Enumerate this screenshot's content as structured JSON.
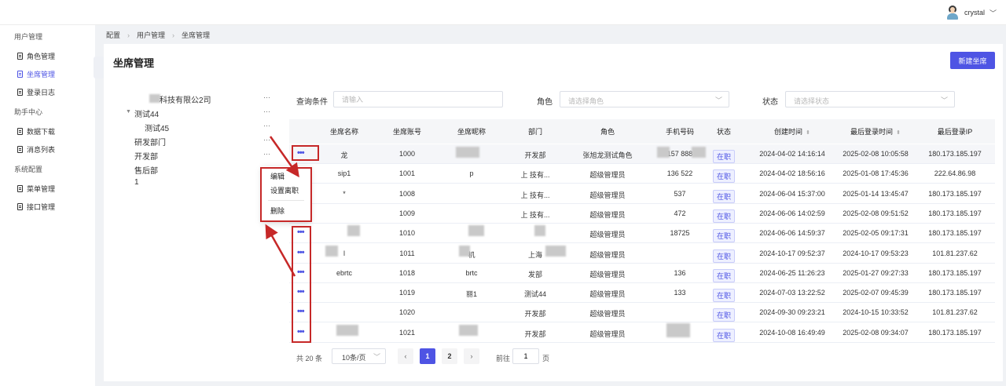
{
  "header": {
    "username": "crystal"
  },
  "sidebar": {
    "groups": [
      {
        "label": "用户管理",
        "items": [
          {
            "label": "角色管理",
            "active": false
          },
          {
            "label": "坐席管理",
            "active": true
          },
          {
            "label": "登录日志",
            "active": false
          }
        ]
      },
      {
        "label": "助手中心",
        "items": [
          {
            "label": "数据下载",
            "active": false
          },
          {
            "label": "消息列表",
            "active": false
          }
        ]
      },
      {
        "label": "系统配置",
        "items": [
          {
            "label": "菜单管理",
            "active": false
          },
          {
            "label": "接口管理",
            "active": false
          }
        ]
      }
    ]
  },
  "breadcrumb": [
    "配置",
    "用户管理",
    "坐席管理"
  ],
  "page": {
    "title": "坐席管理",
    "new_button": "新建坐席"
  },
  "tree": [
    {
      "label": "科技有限公2司"
    },
    {
      "label": "测试44"
    },
    {
      "label": "测试45"
    },
    {
      "label": "研发部门"
    },
    {
      "label": "开发部"
    },
    {
      "label": "售后部"
    },
    {
      "label": "1"
    }
  ],
  "filters": {
    "query_label": "查询条件",
    "query_placeholder": "请输入",
    "role_label": "角色",
    "role_placeholder": "请选择角色",
    "status_label": "状态",
    "status_placeholder": "请选择状态"
  },
  "table": {
    "headers": [
      "坐席名称",
      "坐席账号",
      "坐席昵称",
      "部门",
      "角色",
      "手机号码",
      "状态",
      "创建时间",
      "最后登录时间",
      "最后登录IP"
    ],
    "rows": [
      {
        "name": "龙",
        "account": "1000",
        "nickname": "",
        "dept": "开发部",
        "role": "张旭龙测试角色",
        "phone": "157   888",
        "status": "在职",
        "created": "2024-04-02 14:16:14",
        "last_login": "2025-02-08 10:05:58",
        "ip": "180.173.185.197"
      },
      {
        "name": "sip1",
        "account": "1001",
        "nickname": "p",
        "dept": "上   技有...",
        "role": "超级管理员",
        "phone": "136   522",
        "status": "在职",
        "created": "2024-04-02 18:56:16",
        "last_login": "2025-01-08 17:45:36",
        "ip": "222.64.86.98"
      },
      {
        "name": "*",
        "account": "1008",
        "nickname": "",
        "dept": "上   技有...",
        "role": "超级管理员",
        "phone": "537",
        "status": "在职",
        "created": "2024-06-04 15:37:00",
        "last_login": "2025-01-14 13:45:47",
        "ip": "180.173.185.197"
      },
      {
        "name": "",
        "account": "1009",
        "nickname": "",
        "dept": "上   技有...",
        "role": "超级管理员",
        "phone": "472",
        "status": "在职",
        "created": "2024-06-06 14:02:59",
        "last_login": "2025-02-08 09:51:52",
        "ip": "180.173.185.197"
      },
      {
        "name": "",
        "account": "1010",
        "nickname": "",
        "dept": "",
        "role": "超级管理员",
        "phone": "18725",
        "status": "在职",
        "created": "2024-06-06 14:59:37",
        "last_login": "2025-02-05 09:17:31",
        "ip": "180.173.185.197"
      },
      {
        "name": "l",
        "account": "1011",
        "nickname": "机",
        "dept": "上海",
        "role": "超级管理员",
        "phone": "",
        "status": "在职",
        "created": "2024-10-17 09:52:37",
        "last_login": "2024-10-17 09:53:23",
        "ip": "101.81.237.62"
      },
      {
        "name": "ebrtc",
        "account": "1018",
        "nickname": "brtc",
        "dept": "发部",
        "role": "超级管理员",
        "phone": "136",
        "status": "在职",
        "created": "2024-06-25 11:26:23",
        "last_login": "2025-01-27 09:27:33",
        "ip": "180.173.185.197"
      },
      {
        "name": "",
        "account": "1019",
        "nickname": "丽1",
        "dept": "测试44",
        "role": "超级管理员",
        "phone": "133",
        "status": "在职",
        "created": "2024-07-03 13:22:52",
        "last_login": "2025-02-07 09:45:39",
        "ip": "180.173.185.197"
      },
      {
        "name": "",
        "account": "1020",
        "nickname": "",
        "dept": "开发部",
        "role": "超级管理员",
        "phone": "",
        "status": "在职",
        "created": "2024-09-30 09:23:21",
        "last_login": "2024-10-15 10:33:52",
        "ip": "101.81.237.62"
      },
      {
        "name": "",
        "account": "1021",
        "nickname": "",
        "dept": "开发部",
        "role": "超级管理员",
        "phone": "152",
        "status": "在职",
        "created": "2024-10-08 16:49:49",
        "last_login": "2025-02-08 09:34:07",
        "ip": "180.173.185.197"
      }
    ]
  },
  "context_menu": [
    "编辑",
    "设置离职",
    "删除"
  ],
  "pagination": {
    "total": "共 20 条",
    "page_size": "10条/页",
    "pages": [
      "1",
      "2"
    ],
    "prev": "‹",
    "next": "›",
    "goto_label": "前往",
    "goto_value": "1",
    "page_suffix": "页"
  },
  "colors": {
    "accent": "#4e54e4",
    "annotation": "#c62828"
  }
}
